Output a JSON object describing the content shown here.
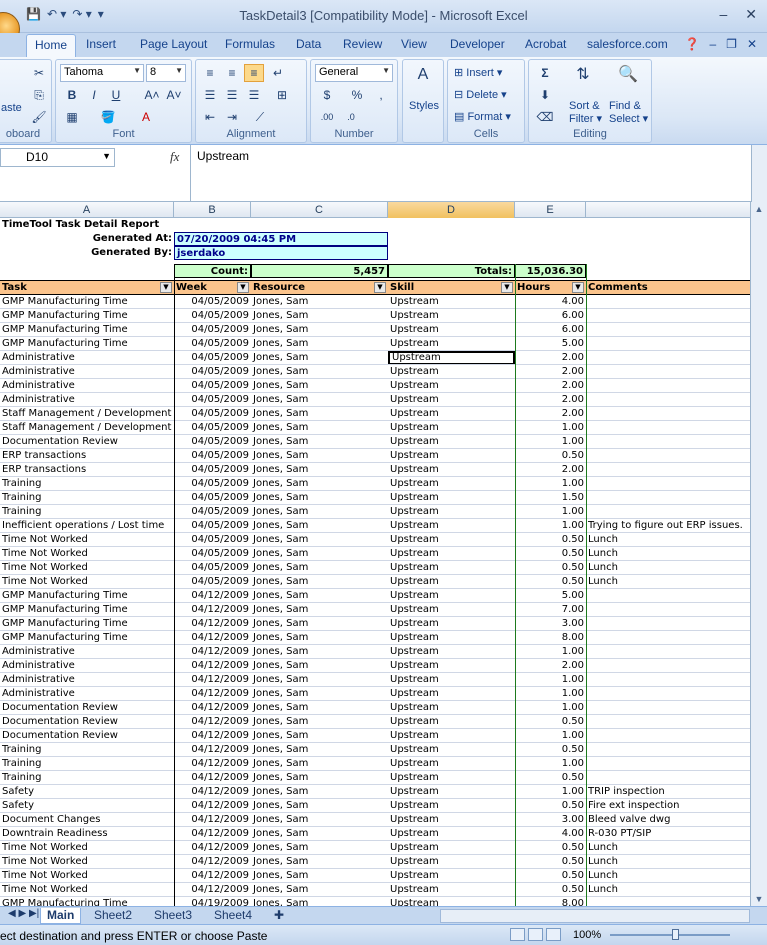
{
  "window": {
    "title": "TaskDetail3  [Compatibility Mode] - Microsoft Excel",
    "controls": [
      "–",
      "✕"
    ]
  },
  "ribbon_tabs": [
    "Home",
    "Insert",
    "Page Layout",
    "Formulas",
    "Data",
    "Review",
    "View",
    "Developer",
    "Acrobat",
    "salesforce.com"
  ],
  "ribbon": {
    "clipboard_label": "oboard",
    "paste_label": "aste",
    "font_label": "Font",
    "font_name": "Tahoma",
    "font_size": "8",
    "alignment_label": "Alignment",
    "number_label": "Number",
    "number_format": "General",
    "styles_label": "Styles",
    "insert_label": "Insert",
    "delete_label": "Delete",
    "format_label": "Format",
    "cells_label": "Cells",
    "sort_label": "Sort &",
    "filter_label": "Filter",
    "find_label": "Find &",
    "select_label": "Select",
    "editing_label": "Editing"
  },
  "formula_bar": {
    "name_box": "D10",
    "fx": "fx",
    "content": "Upstream"
  },
  "columns": [
    "A",
    "B",
    "C",
    "D",
    "E"
  ],
  "report": {
    "title": "TimeTool Task Detail Report",
    "generated_at_label": "Generated At:",
    "generated_at_value": "07/20/2009 04:45 PM",
    "generated_by_label": "Generated By:",
    "generated_by_value": "jserdako",
    "count_label": "Count:",
    "count_value": "5,457",
    "totals_label": "Totals:",
    "totals_value": "15,036.30"
  },
  "table_headers": [
    "Task",
    "Week",
    "Resource",
    "Skill",
    "Hours",
    "Comments"
  ],
  "rows": [
    [
      "GMP Manufacturing Time",
      "04/05/2009",
      "Jones, Sam",
      "Upstream",
      "4.00",
      ""
    ],
    [
      "GMP Manufacturing Time",
      "04/05/2009",
      "Jones, Sam",
      "Upstream",
      "6.00",
      ""
    ],
    [
      "GMP Manufacturing Time",
      "04/05/2009",
      "Jones, Sam",
      "Upstream",
      "6.00",
      ""
    ],
    [
      "GMP Manufacturing Time",
      "04/05/2009",
      "Jones, Sam",
      "Upstream",
      "5.00",
      ""
    ],
    [
      "Administrative",
      "04/05/2009",
      "Jones, Sam",
      "Upstream",
      "2.00",
      ""
    ],
    [
      "Administrative",
      "04/05/2009",
      "Jones, Sam",
      "Upstream",
      "2.00",
      ""
    ],
    [
      "Administrative",
      "04/05/2009",
      "Jones, Sam",
      "Upstream",
      "2.00",
      ""
    ],
    [
      "Administrative",
      "04/05/2009",
      "Jones, Sam",
      "Upstream",
      "2.00",
      ""
    ],
    [
      "Staff Management / Development",
      "04/05/2009",
      "Jones, Sam",
      "Upstream",
      "2.00",
      ""
    ],
    [
      "Staff Management / Development",
      "04/05/2009",
      "Jones, Sam",
      "Upstream",
      "1.00",
      ""
    ],
    [
      "Documentation Review",
      "04/05/2009",
      "Jones, Sam",
      "Upstream",
      "1.00",
      ""
    ],
    [
      "ERP transactions",
      "04/05/2009",
      "Jones, Sam",
      "Upstream",
      "0.50",
      ""
    ],
    [
      "ERP transactions",
      "04/05/2009",
      "Jones, Sam",
      "Upstream",
      "2.00",
      ""
    ],
    [
      "Training",
      "04/05/2009",
      "Jones, Sam",
      "Upstream",
      "1.00",
      ""
    ],
    [
      "Training",
      "04/05/2009",
      "Jones, Sam",
      "Upstream",
      "1.50",
      ""
    ],
    [
      "Training",
      "04/05/2009",
      "Jones, Sam",
      "Upstream",
      "1.00",
      ""
    ],
    [
      "Inefficient operations / Lost time",
      "04/05/2009",
      "Jones, Sam",
      "Upstream",
      "1.00",
      "Trying to figure out ERP issues."
    ],
    [
      "Time Not Worked",
      "04/05/2009",
      "Jones, Sam",
      "Upstream",
      "0.50",
      "Lunch"
    ],
    [
      "Time Not Worked",
      "04/05/2009",
      "Jones, Sam",
      "Upstream",
      "0.50",
      "Lunch"
    ],
    [
      "Time Not Worked",
      "04/05/2009",
      "Jones, Sam",
      "Upstream",
      "0.50",
      "Lunch"
    ],
    [
      "Time Not Worked",
      "04/05/2009",
      "Jones, Sam",
      "Upstream",
      "0.50",
      "Lunch"
    ],
    [
      "GMP Manufacturing Time",
      "04/12/2009",
      "Jones, Sam",
      "Upstream",
      "5.00",
      ""
    ],
    [
      "GMP Manufacturing Time",
      "04/12/2009",
      "Jones, Sam",
      "Upstream",
      "7.00",
      ""
    ],
    [
      "GMP Manufacturing Time",
      "04/12/2009",
      "Jones, Sam",
      "Upstream",
      "3.00",
      ""
    ],
    [
      "GMP Manufacturing Time",
      "04/12/2009",
      "Jones, Sam",
      "Upstream",
      "8.00",
      ""
    ],
    [
      "Administrative",
      "04/12/2009",
      "Jones, Sam",
      "Upstream",
      "1.00",
      ""
    ],
    [
      "Administrative",
      "04/12/2009",
      "Jones, Sam",
      "Upstream",
      "2.00",
      ""
    ],
    [
      "Administrative",
      "04/12/2009",
      "Jones, Sam",
      "Upstream",
      "1.00",
      ""
    ],
    [
      "Administrative",
      "04/12/2009",
      "Jones, Sam",
      "Upstream",
      "1.00",
      ""
    ],
    [
      "Documentation Review",
      "04/12/2009",
      "Jones, Sam",
      "Upstream",
      "1.00",
      ""
    ],
    [
      "Documentation Review",
      "04/12/2009",
      "Jones, Sam",
      "Upstream",
      "0.50",
      ""
    ],
    [
      "Documentation Review",
      "04/12/2009",
      "Jones, Sam",
      "Upstream",
      "1.00",
      ""
    ],
    [
      "Training",
      "04/12/2009",
      "Jones, Sam",
      "Upstream",
      "0.50",
      ""
    ],
    [
      "Training",
      "04/12/2009",
      "Jones, Sam",
      "Upstream",
      "1.00",
      ""
    ],
    [
      "Training",
      "04/12/2009",
      "Jones, Sam",
      "Upstream",
      "0.50",
      ""
    ],
    [
      "Safety",
      "04/12/2009",
      "Jones, Sam",
      "Upstream",
      "1.00",
      "TRIP inspection"
    ],
    [
      "Safety",
      "04/12/2009",
      "Jones, Sam",
      "Upstream",
      "0.50",
      "Fire ext inspection"
    ],
    [
      "Document Changes",
      "04/12/2009",
      "Jones, Sam",
      "Upstream",
      "3.00",
      "Bleed valve dwg"
    ],
    [
      "Downtrain Readiness",
      "04/12/2009",
      "Jones, Sam",
      "Upstream",
      "4.00",
      "R-030 PT/SIP"
    ],
    [
      "Time Not Worked",
      "04/12/2009",
      "Jones, Sam",
      "Upstream",
      "0.50",
      "Lunch"
    ],
    [
      "Time Not Worked",
      "04/12/2009",
      "Jones, Sam",
      "Upstream",
      "0.50",
      "Lunch"
    ],
    [
      "Time Not Worked",
      "04/12/2009",
      "Jones, Sam",
      "Upstream",
      "0.50",
      "Lunch"
    ],
    [
      "Time Not Worked",
      "04/12/2009",
      "Jones, Sam",
      "Upstream",
      "0.50",
      "Lunch"
    ],
    [
      "GMP Manufacturing Time",
      "04/19/2009",
      "Jones, Sam",
      "Upstream",
      "8.00",
      ""
    ]
  ],
  "sheet_tabs": [
    "Main",
    "Sheet2",
    "Sheet3",
    "Sheet4"
  ],
  "status": {
    "message": "ect destination and press ENTER or choose Paste",
    "zoom": "100%"
  },
  "colors": {
    "header_fill": "#fbc48c",
    "count_fill": "#ccffcc",
    "info_fill": "#ccffff",
    "selected_col": "#f1c15f"
  }
}
